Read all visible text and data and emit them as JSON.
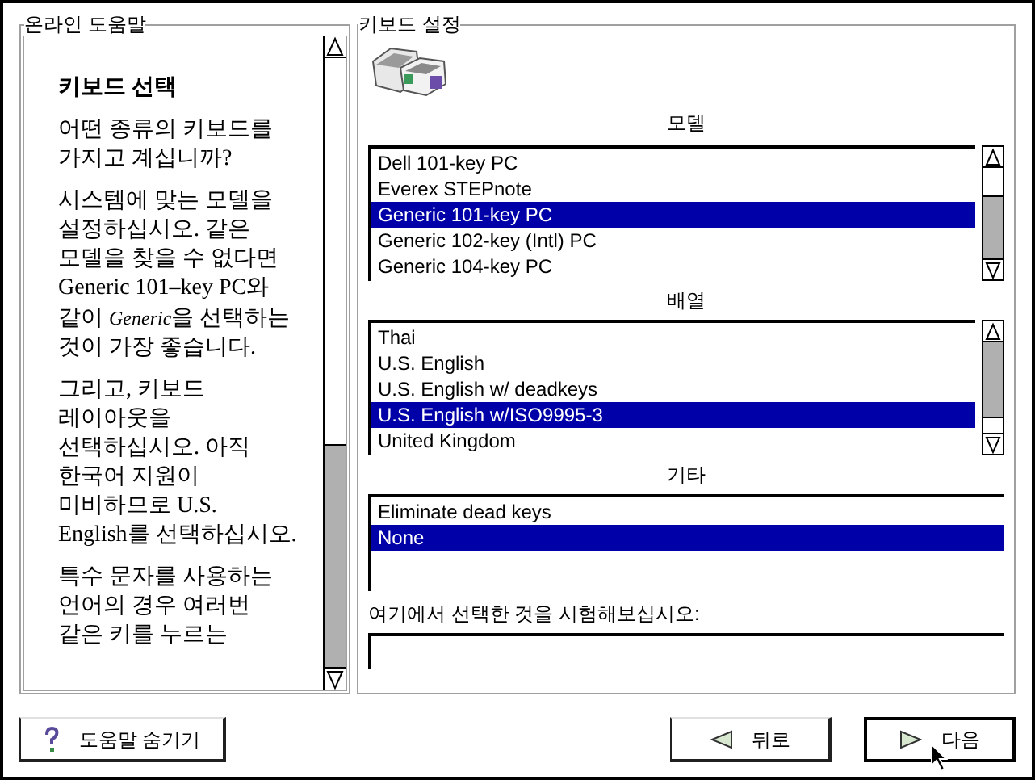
{
  "help_panel": {
    "title": "온라인 도움말",
    "heading": "키보드 선택",
    "paragraphs": [
      {
        "lines": [
          [
            {
              "text": "어떤 종류의 키보드를",
              "italic": false
            }
          ],
          [
            {
              "text": "가지고 계십니까?",
              "italic": false
            }
          ]
        ]
      },
      {
        "lines": [
          [
            {
              "text": "시스템에 맞는 모델을",
              "italic": false
            }
          ],
          [
            {
              "text": "설정하십시오. 같은",
              "italic": false
            }
          ],
          [
            {
              "text": "모델을 찾을 수 없다면",
              "italic": false
            }
          ],
          [
            {
              "text": "Generic 101–key PC와",
              "italic": false
            }
          ],
          [
            {
              "text": "같이 ",
              "italic": false
            },
            {
              "text": "Generic",
              "italic": true
            },
            {
              "text": "을 선택하는",
              "italic": false
            }
          ],
          [
            {
              "text": "것이 가장 좋습니다.",
              "italic": false
            }
          ]
        ]
      },
      {
        "lines": [
          [
            {
              "text": "그리고, 키보드",
              "italic": false
            }
          ],
          [
            {
              "text": "레이아웃을",
              "italic": false
            }
          ],
          [
            {
              "text": "선택하십시오. 아직",
              "italic": false
            }
          ],
          [
            {
              "text": "한국어 지원이",
              "italic": false
            }
          ],
          [
            {
              "text": "미비하므로 U.S.",
              "italic": false
            }
          ],
          [
            {
              "text": "English를 선택하십시오.",
              "italic": false
            }
          ]
        ]
      },
      {
        "lines": [
          [
            {
              "text": "특수 문자를 사용하는",
              "italic": false
            }
          ],
          [
            {
              "text": "언어의 경우 여러번",
              "italic": false
            }
          ],
          [
            {
              "text": "같은 키를 누르는",
              "italic": false
            }
          ]
        ]
      }
    ]
  },
  "settings_panel": {
    "title": "키보드 설정",
    "model": {
      "label": "모델",
      "items": [
        {
          "label": "Dell 101-key PC",
          "selected": false
        },
        {
          "label": "Everex STEPnote",
          "selected": false
        },
        {
          "label": "Generic 101-key PC",
          "selected": true
        },
        {
          "label": "Generic 102-key (Intl) PC",
          "selected": false
        },
        {
          "label": "Generic 104-key PC",
          "selected": false
        }
      ]
    },
    "layout": {
      "label": "배열",
      "items": [
        {
          "label": "Thai",
          "selected": false
        },
        {
          "label": "U.S. English",
          "selected": false
        },
        {
          "label": "U.S. English w/ deadkeys",
          "selected": false
        },
        {
          "label": "U.S. English w/ISO9995-3",
          "selected": true
        },
        {
          "label": "United Kingdom",
          "selected": false
        }
      ]
    },
    "other": {
      "label": "기타",
      "items": [
        {
          "label": "Eliminate dead keys",
          "selected": false
        },
        {
          "label": "None",
          "selected": true
        }
      ]
    },
    "test": {
      "label": "여기에서 선택한 것을 시험해보십시오:"
    }
  },
  "buttons": [
    {
      "kind": "help",
      "label": "도움말 숨기기",
      "default": false
    },
    {
      "kind": "back",
      "label": "뒤로",
      "default": false
    },
    {
      "kind": "next",
      "label": "다음",
      "default": true
    }
  ]
}
